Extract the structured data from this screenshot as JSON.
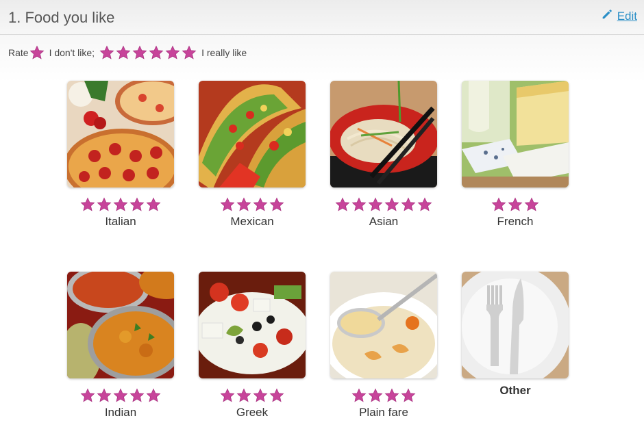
{
  "header": {
    "title": "1. Food you like",
    "edit_label": "Edit"
  },
  "rating_hint": {
    "rate_label": "Rate",
    "dislike_label": "I don't like;",
    "like_label": "I really like"
  },
  "colors": {
    "star": "#c0408c",
    "link": "#2b8fc7"
  },
  "foods": [
    {
      "name": "Italian",
      "stars": 5,
      "icon": "pizza-image"
    },
    {
      "name": "Mexican",
      "stars": 4,
      "icon": "taco-image"
    },
    {
      "name": "Asian",
      "stars": 6,
      "icon": "noodles-image"
    },
    {
      "name": "French",
      "stars": 3,
      "icon": "cheese-image"
    },
    {
      "name": "Indian",
      "stars": 5,
      "icon": "curry-image"
    },
    {
      "name": "Greek",
      "stars": 4,
      "icon": "salad-image"
    },
    {
      "name": "Plain fare",
      "stars": 4,
      "icon": "pasta-soup-image"
    },
    {
      "name": "Other",
      "stars": 0,
      "icon": "plate-cutlery-image"
    }
  ]
}
